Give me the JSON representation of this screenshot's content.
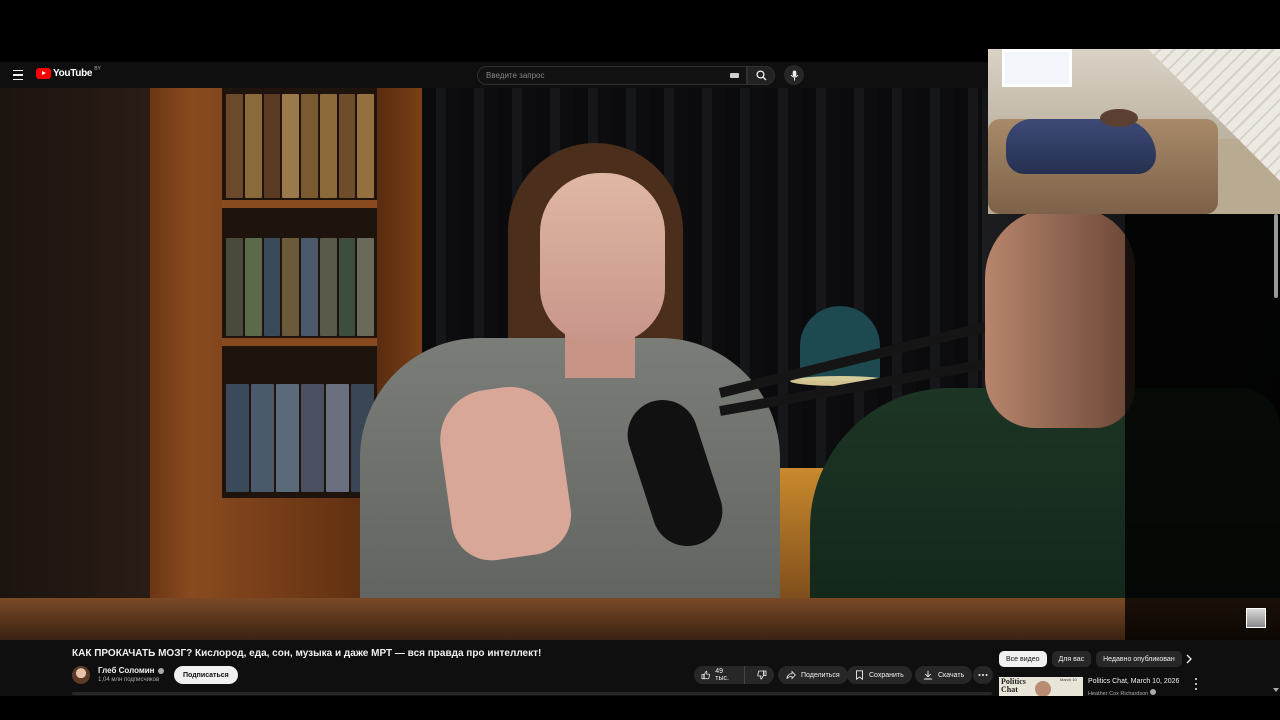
{
  "masthead": {
    "logo_text": "YouTube",
    "region": "BY",
    "search_placeholder": "Введите запрос"
  },
  "video": {
    "title": "КАК ПРОКАЧАТЬ МОЗГ? Кислород, еда, сон, музыка и даже МРТ — вся правда про интеллект!"
  },
  "channel": {
    "name": "Глеб Соломин",
    "subscribers": "1,04 млн подписчиков",
    "subscribe_label": "Подписаться"
  },
  "actions": {
    "likes": "49 тыс.",
    "share_label": "Поделиться",
    "save_label": "Сохранить",
    "download_label": "Скачать"
  },
  "chips": [
    {
      "label": "Все видео",
      "active": true
    },
    {
      "label": "Для вас",
      "active": false
    },
    {
      "label": "Недавно опубликован",
      "active": false
    }
  ],
  "recommendation": {
    "thumb_title_line1": "Politics",
    "thumb_title_line2": "Chat",
    "thumb_date": "March 10",
    "title": "Politics Chat, March 10, 2026",
    "channel": "Heather Cox Richardson"
  },
  "colors": {
    "brand_red": "#ff0000",
    "background": "#0f0f0f",
    "pill": "#272727"
  }
}
